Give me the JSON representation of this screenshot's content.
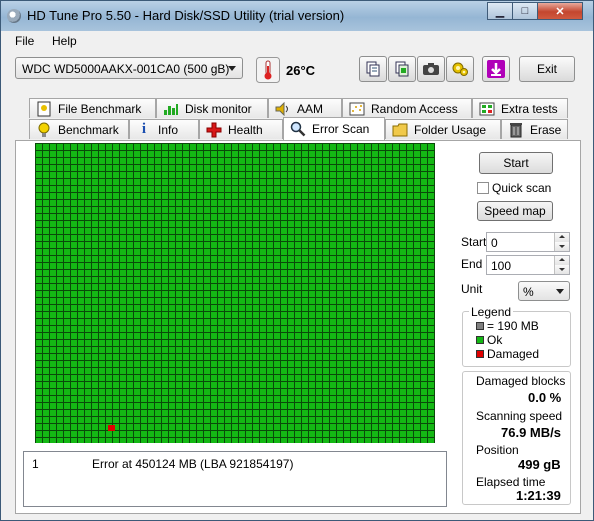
{
  "window": {
    "title": "HD Tune Pro 5.50 - Hard Disk/SSD Utility (trial version)",
    "minimize_icon": "minimize-icon",
    "maximize_icon": "maximize-icon",
    "close_icon": "close-icon"
  },
  "menu": {
    "items": [
      "File",
      "Help"
    ]
  },
  "toolbar": {
    "drive": "WDC WD5000AAKX-001CA0 (500 gB)",
    "temperature": "26°C",
    "exit_label": "Exit",
    "icons": [
      "copy-text-icon",
      "copy-info-icon",
      "screenshot-icon",
      "options-icon",
      "download-icon"
    ]
  },
  "tabs": {
    "top": [
      "File Benchmark",
      "Disk monitor",
      "AAM",
      "Random Access",
      "Extra tests"
    ],
    "bottom": [
      "Benchmark",
      "Info",
      "Health",
      "Error Scan",
      "Folder Usage",
      "Erase"
    ],
    "active": "Error Scan"
  },
  "scan": {
    "start_label": "Start",
    "quick_scan_label": "Quick scan",
    "speed_map_label": "Speed map",
    "start_field_label": "Start",
    "start_value": "0",
    "end_field_label": "End",
    "end_value": "100",
    "unit_label": "Unit",
    "unit_value": "%"
  },
  "legend": {
    "title": "Legend",
    "block": "= 190 MB",
    "ok": "Ok",
    "damaged": "Damaged",
    "colors": {
      "block": "#808080",
      "ok": "#14b814",
      "damaged": "#e00000"
    }
  },
  "stats": {
    "damaged_label": "Damaged blocks",
    "damaged_value": "0.0 %",
    "speed_label": "Scanning speed",
    "speed_value": "76.9 MB/s",
    "position_label": "Position",
    "position_value": "499 gB",
    "elapsed_label": "Elapsed time",
    "elapsed_value": "1:21:39"
  },
  "errors": [
    {
      "index": "1",
      "text": "Error at 450124 MB (LBA 921854197)"
    }
  ]
}
